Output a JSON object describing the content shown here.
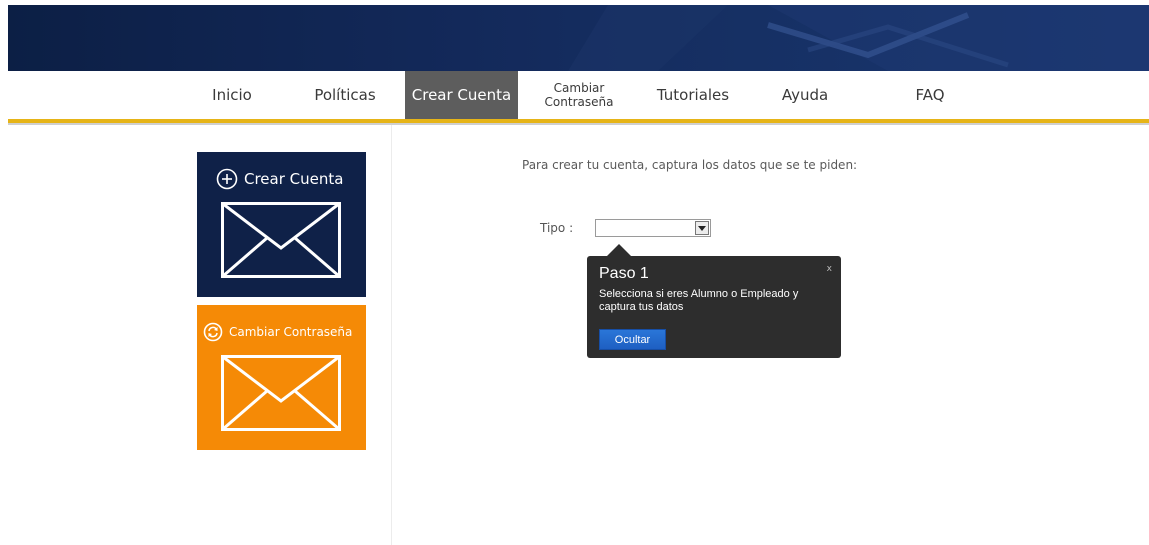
{
  "nav": {
    "items": [
      {
        "label": "Inicio"
      },
      {
        "label": "Políticas"
      },
      {
        "label": "Crear Cuenta"
      },
      {
        "label_line1": "Cambiar",
        "label_line2": "Contraseña"
      },
      {
        "label": "Tutoriales"
      },
      {
        "label": "Ayuda"
      },
      {
        "label": "FAQ"
      }
    ],
    "active": "Crear Cuenta"
  },
  "tiles": {
    "create": {
      "label": "Crear Cuenta",
      "icon": "plus-circle-icon",
      "color": "#0f2148"
    },
    "change": {
      "label": "Cambiar Contraseña",
      "icon": "refresh-circle-icon",
      "color": "#f58a06"
    }
  },
  "main": {
    "intro": "Para crear tu cuenta, captura los datos que se te piden:",
    "tipo_label": "Tipo :",
    "tipo_value": ""
  },
  "tooltip": {
    "title": "Paso 1",
    "body": "Selecciona si eres Alumno o Empleado y captura tus datos",
    "button": "Ocultar",
    "close": "x"
  },
  "colors": {
    "banner": "#13295a",
    "accent_gold": "#e6b417",
    "active_tab": "#5d5d5d",
    "button_blue": "#1e5fc2"
  }
}
